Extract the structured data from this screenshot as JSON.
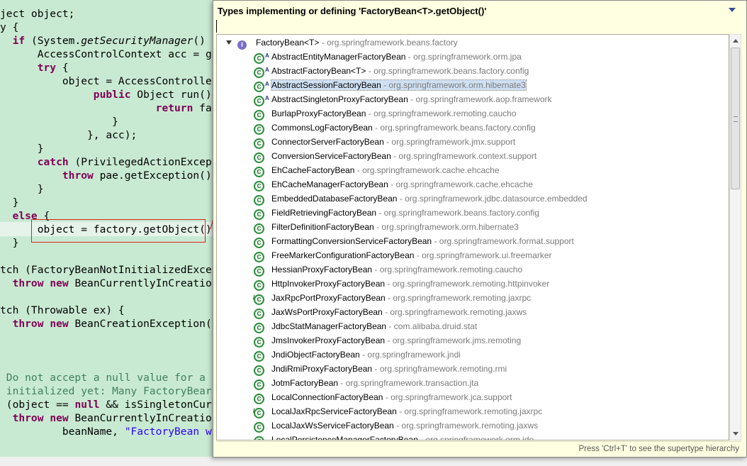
{
  "editor": {
    "lines": [
      [
        "ject object;"
      ],
      [
        "y {"
      ],
      [
        "  ",
        {
          "k": "if"
        },
        " (System.",
        {
          "i": "getSecurityManager"
        },
        "()"
      ],
      [
        "      AccessControlContext acc = g"
      ],
      [
        "      ",
        {
          "k": "try"
        },
        " {"
      ],
      [
        "          object = AccessControlle"
      ],
      [
        "               ",
        {
          "k": "public"
        },
        " Object run()"
      ],
      [
        "                         ",
        {
          "k": "return"
        },
        " facto"
      ],
      [
        "                  }"
      ],
      [
        "              }, acc);"
      ],
      [
        "      }"
      ],
      [
        "      ",
        {
          "k": "catch"
        },
        " (PrivilegedActionExcep"
      ],
      [
        "          ",
        {
          "k": "throw"
        },
        " pae.getException()"
      ],
      [
        "      }"
      ],
      [
        "  }"
      ],
      [
        "  ",
        {
          "k": "else"
        },
        " {"
      ],
      [
        "      object = factory.getObject()"
      ],
      [
        "  }"
      ],
      [
        ""
      ],
      [
        "tch (FactoryBeanNotInitializedExce"
      ],
      [
        "  ",
        {
          "k": "throw"
        },
        " ",
        {
          "k": "new"
        },
        " BeanCurrentlyInCreatio"
      ],
      [
        ""
      ],
      [
        "tch (Throwable ex) {"
      ],
      [
        "  ",
        {
          "k": "throw"
        },
        " ",
        {
          "k": "new"
        },
        " BeanCreationException("
      ],
      [
        ""
      ],
      [
        ""
      ],
      [
        ""
      ],
      [
        {
          "c": " Do not accept a null value for a "
        }
      ],
      [
        {
          "c": " initialized yet: Many FactoryBear"
        }
      ],
      [
        " (object == ",
        {
          "k": "null"
        },
        " && isSingletonCur"
      ],
      [
        "  ",
        {
          "k": "throw"
        },
        " ",
        {
          "k": "new"
        },
        " BeanCurrentlyInCreatio"
      ],
      [
        "          beanName, ",
        {
          "s": "\"FactoryBean w"
        }
      ]
    ]
  },
  "popup": {
    "title": "Types implementing or defining 'FactoryBean<T>.getObject()'",
    "filter_value": "",
    "status": "Press 'Ctrl+T' to see the supertype hierarchy",
    "root": {
      "name": "FactoryBean<T>",
      "package": "org.springframework.beans.factory",
      "icon": "interface-icon"
    },
    "items": [
      {
        "name": "AbstractEntityManagerFactoryBean",
        "package": "org.springframework.orm.jpa",
        "icon": "abstract-class-icon",
        "abstract": true
      },
      {
        "name": "AbstractFactoryBean<T>",
        "package": "org.springframework.beans.factory.config",
        "icon": "abstract-class-icon",
        "abstract": true
      },
      {
        "name": "AbstractSessionFactoryBean",
        "package": "org.springframework.orm.hibernate3",
        "icon": "abstract-class-icon",
        "abstract": true,
        "selected": true
      },
      {
        "name": "AbstractSingletonProxyFactoryBean",
        "package": "org.springframework.aop.framework",
        "icon": "abstract-class-icon",
        "abstract": true
      },
      {
        "name": "BurlapProxyFactoryBean",
        "package": "org.springframework.remoting.caucho",
        "icon": "class-icon"
      },
      {
        "name": "CommonsLogFactoryBean",
        "package": "org.springframework.beans.factory.config",
        "icon": "class-icon"
      },
      {
        "name": "ConnectorServerFactoryBean",
        "package": "org.springframework.jmx.support",
        "icon": "class-icon"
      },
      {
        "name": "ConversionServiceFactoryBean",
        "package": "org.springframework.context.support",
        "icon": "class-icon"
      },
      {
        "name": "EhCacheFactoryBean",
        "package": "org.springframework.cache.ehcache",
        "icon": "class-icon"
      },
      {
        "name": "EhCacheManagerFactoryBean",
        "package": "org.springframework.cache.ehcache",
        "icon": "class-icon"
      },
      {
        "name": "EmbeddedDatabaseFactoryBean",
        "package": "org.springframework.jdbc.datasource.embedded",
        "icon": "class-icon"
      },
      {
        "name": "FieldRetrievingFactoryBean",
        "package": "org.springframework.beans.factory.config",
        "icon": "class-icon"
      },
      {
        "name": "FilterDefinitionFactoryBean",
        "package": "org.springframework.orm.hibernate3",
        "icon": "class-icon"
      },
      {
        "name": "FormattingConversionServiceFactoryBean",
        "package": "org.springframework.format.support",
        "icon": "class-icon"
      },
      {
        "name": "FreeMarkerConfigurationFactoryBean",
        "package": "org.springframework.ui.freemarker",
        "icon": "class-icon"
      },
      {
        "name": "HessianProxyFactoryBean",
        "package": "org.springframework.remoting.caucho",
        "icon": "class-icon"
      },
      {
        "name": "HttpInvokerProxyFactoryBean",
        "package": "org.springframework.remoting.httpinvoker",
        "icon": "class-icon"
      },
      {
        "name": "JaxRpcPortProxyFactoryBean",
        "package": "org.springframework.remoting.jaxrpc",
        "icon": "deprecated-class-icon",
        "deprecated": true
      },
      {
        "name": "JaxWsPortProxyFactoryBean",
        "package": "org.springframework.remoting.jaxws",
        "icon": "class-icon"
      },
      {
        "name": "JdbcStatManagerFactoryBean",
        "package": "com.alibaba.druid.stat",
        "icon": "class-icon"
      },
      {
        "name": "JmsInvokerProxyFactoryBean",
        "package": "org.springframework.jms.remoting",
        "icon": "class-icon"
      },
      {
        "name": "JndiObjectFactoryBean",
        "package": "org.springframework.jndi",
        "icon": "class-icon"
      },
      {
        "name": "JndiRmiProxyFactoryBean",
        "package": "org.springframework.remoting.rmi",
        "icon": "class-icon"
      },
      {
        "name": "JotmFactoryBean",
        "package": "org.springframework.transaction.jta",
        "icon": "class-icon"
      },
      {
        "name": "LocalConnectionFactoryBean",
        "package": "org.springframework.jca.support",
        "icon": "class-icon"
      },
      {
        "name": "LocalJaxRpcServiceFactoryBean",
        "package": "org.springframework.remoting.jaxrpc",
        "icon": "deprecated-class-icon",
        "deprecated": true
      },
      {
        "name": "LocalJaxWsServiceFactoryBean",
        "package": "org.springframework.remoting.jaxws",
        "icon": "class-icon"
      },
      {
        "name": "LocalPersistenceManagerFactoryBean",
        "package": "org.springframework.orm.jdo",
        "icon": "class-icon"
      }
    ]
  },
  "colors": {
    "editor_bg": "#c9ead2",
    "popup_bg": "#ffffe1",
    "selection_bg": "#cfe0f3",
    "keyword": "#7f0055",
    "annotation_red": "#d8241f"
  }
}
